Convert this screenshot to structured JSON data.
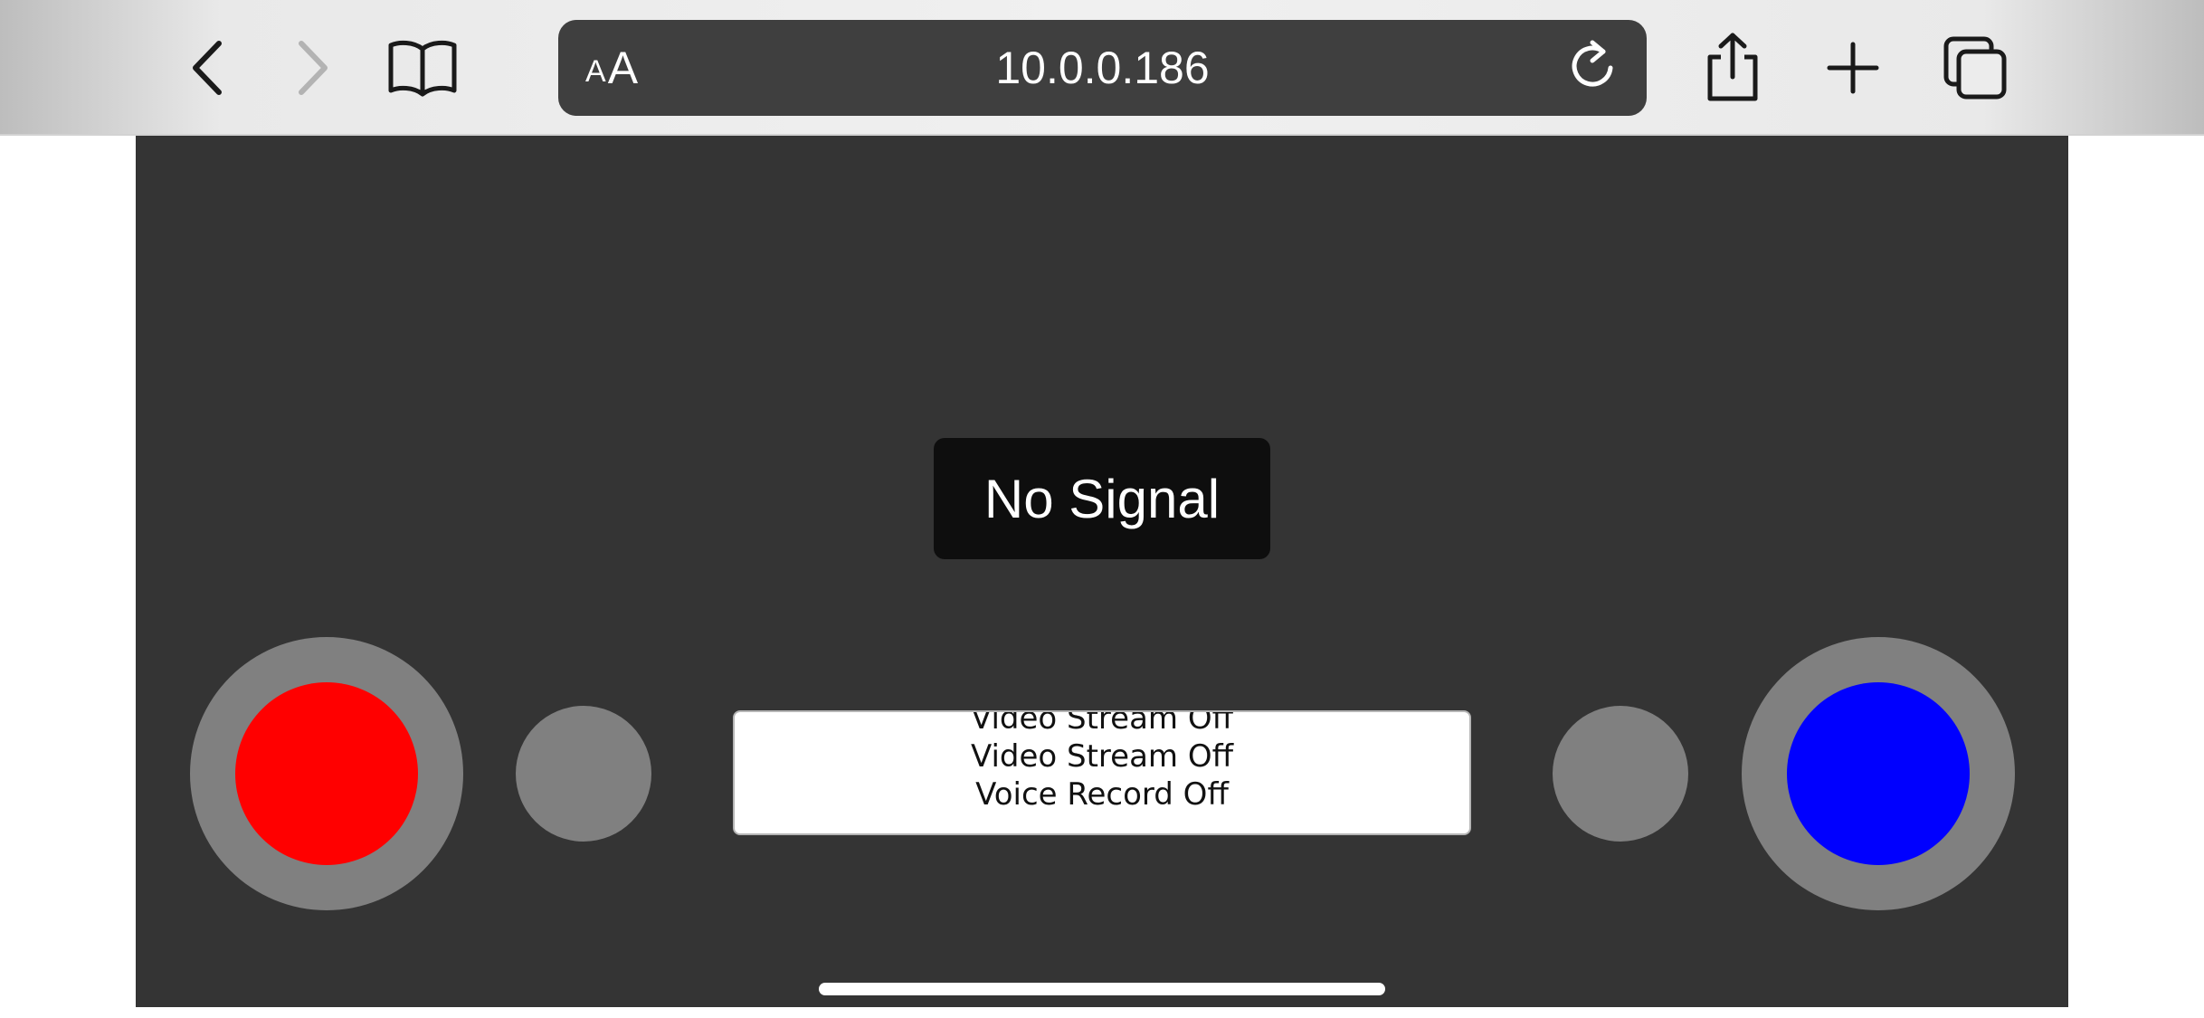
{
  "browser": {
    "address_bar": {
      "reader_small": "A",
      "reader_big": "A",
      "url": "10.0.0.186"
    },
    "icons": {
      "back": "chevron-left-icon",
      "forward": "chevron-right-icon",
      "bookmarks": "book-icon",
      "reload": "reload-icon",
      "share": "share-icon",
      "new_tab": "plus-icon",
      "tabs": "tabs-icon"
    },
    "forward_enabled": false
  },
  "page": {
    "background_color": "#343434",
    "video": {
      "status_text": "No Signal"
    },
    "left_joystick": {
      "outer_color": "#808080",
      "knob_color": "#ff0000"
    },
    "right_joystick": {
      "outer_color": "#808080",
      "knob_color": "#0000ff"
    },
    "status_lines": [
      "Video Stream Off",
      "Video Stream Off",
      "Voice Record Off"
    ]
  }
}
